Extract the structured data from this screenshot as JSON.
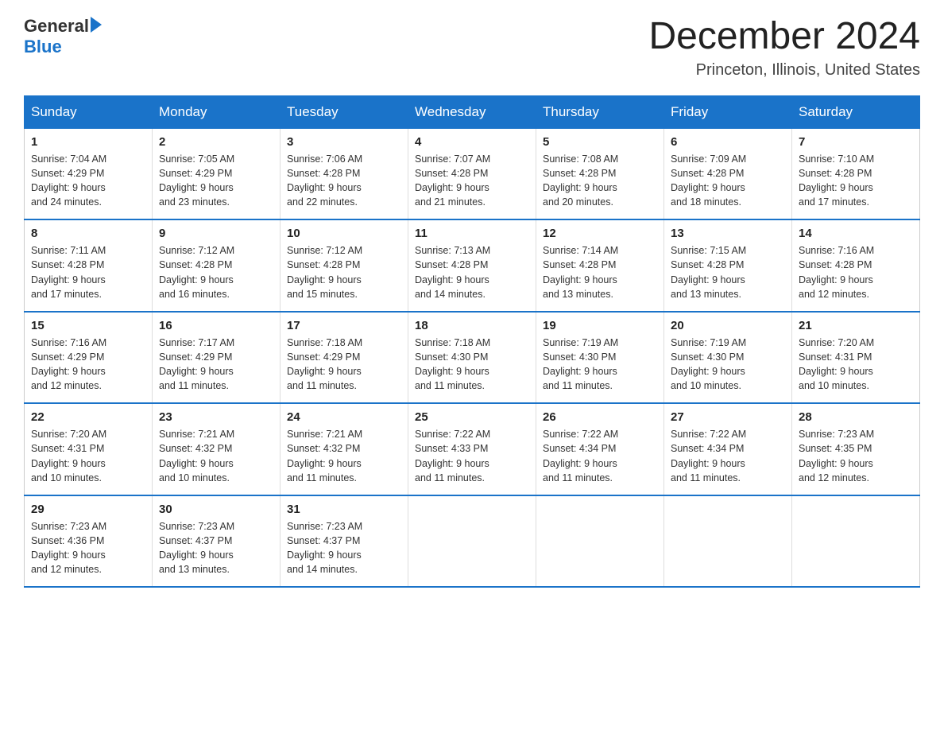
{
  "logo": {
    "text_general": "General",
    "text_blue": "Blue"
  },
  "header": {
    "month_title": "December 2024",
    "location": "Princeton, Illinois, United States"
  },
  "weekdays": [
    "Sunday",
    "Monday",
    "Tuesday",
    "Wednesday",
    "Thursday",
    "Friday",
    "Saturday"
  ],
  "weeks": [
    [
      {
        "day": "1",
        "sunrise": "7:04 AM",
        "sunset": "4:29 PM",
        "daylight": "9 hours and 24 minutes."
      },
      {
        "day": "2",
        "sunrise": "7:05 AM",
        "sunset": "4:29 PM",
        "daylight": "9 hours and 23 minutes."
      },
      {
        "day": "3",
        "sunrise": "7:06 AM",
        "sunset": "4:28 PM",
        "daylight": "9 hours and 22 minutes."
      },
      {
        "day": "4",
        "sunrise": "7:07 AM",
        "sunset": "4:28 PM",
        "daylight": "9 hours and 21 minutes."
      },
      {
        "day": "5",
        "sunrise": "7:08 AM",
        "sunset": "4:28 PM",
        "daylight": "9 hours and 20 minutes."
      },
      {
        "day": "6",
        "sunrise": "7:09 AM",
        "sunset": "4:28 PM",
        "daylight": "9 hours and 18 minutes."
      },
      {
        "day": "7",
        "sunrise": "7:10 AM",
        "sunset": "4:28 PM",
        "daylight": "9 hours and 17 minutes."
      }
    ],
    [
      {
        "day": "8",
        "sunrise": "7:11 AM",
        "sunset": "4:28 PM",
        "daylight": "9 hours and 17 minutes."
      },
      {
        "day": "9",
        "sunrise": "7:12 AM",
        "sunset": "4:28 PM",
        "daylight": "9 hours and 16 minutes."
      },
      {
        "day": "10",
        "sunrise": "7:12 AM",
        "sunset": "4:28 PM",
        "daylight": "9 hours and 15 minutes."
      },
      {
        "day": "11",
        "sunrise": "7:13 AM",
        "sunset": "4:28 PM",
        "daylight": "9 hours and 14 minutes."
      },
      {
        "day": "12",
        "sunrise": "7:14 AM",
        "sunset": "4:28 PM",
        "daylight": "9 hours and 13 minutes."
      },
      {
        "day": "13",
        "sunrise": "7:15 AM",
        "sunset": "4:28 PM",
        "daylight": "9 hours and 13 minutes."
      },
      {
        "day": "14",
        "sunrise": "7:16 AM",
        "sunset": "4:28 PM",
        "daylight": "9 hours and 12 minutes."
      }
    ],
    [
      {
        "day": "15",
        "sunrise": "7:16 AM",
        "sunset": "4:29 PM",
        "daylight": "9 hours and 12 minutes."
      },
      {
        "day": "16",
        "sunrise": "7:17 AM",
        "sunset": "4:29 PM",
        "daylight": "9 hours and 11 minutes."
      },
      {
        "day": "17",
        "sunrise": "7:18 AM",
        "sunset": "4:29 PM",
        "daylight": "9 hours and 11 minutes."
      },
      {
        "day": "18",
        "sunrise": "7:18 AM",
        "sunset": "4:30 PM",
        "daylight": "9 hours and 11 minutes."
      },
      {
        "day": "19",
        "sunrise": "7:19 AM",
        "sunset": "4:30 PM",
        "daylight": "9 hours and 11 minutes."
      },
      {
        "day": "20",
        "sunrise": "7:19 AM",
        "sunset": "4:30 PM",
        "daylight": "9 hours and 10 minutes."
      },
      {
        "day": "21",
        "sunrise": "7:20 AM",
        "sunset": "4:31 PM",
        "daylight": "9 hours and 10 minutes."
      }
    ],
    [
      {
        "day": "22",
        "sunrise": "7:20 AM",
        "sunset": "4:31 PM",
        "daylight": "9 hours and 10 minutes."
      },
      {
        "day": "23",
        "sunrise": "7:21 AM",
        "sunset": "4:32 PM",
        "daylight": "9 hours and 10 minutes."
      },
      {
        "day": "24",
        "sunrise": "7:21 AM",
        "sunset": "4:32 PM",
        "daylight": "9 hours and 11 minutes."
      },
      {
        "day": "25",
        "sunrise": "7:22 AM",
        "sunset": "4:33 PM",
        "daylight": "9 hours and 11 minutes."
      },
      {
        "day": "26",
        "sunrise": "7:22 AM",
        "sunset": "4:34 PM",
        "daylight": "9 hours and 11 minutes."
      },
      {
        "day": "27",
        "sunrise": "7:22 AM",
        "sunset": "4:34 PM",
        "daylight": "9 hours and 11 minutes."
      },
      {
        "day": "28",
        "sunrise": "7:23 AM",
        "sunset": "4:35 PM",
        "daylight": "9 hours and 12 minutes."
      }
    ],
    [
      {
        "day": "29",
        "sunrise": "7:23 AM",
        "sunset": "4:36 PM",
        "daylight": "9 hours and 12 minutes."
      },
      {
        "day": "30",
        "sunrise": "7:23 AM",
        "sunset": "4:37 PM",
        "daylight": "9 hours and 13 minutes."
      },
      {
        "day": "31",
        "sunrise": "7:23 AM",
        "sunset": "4:37 PM",
        "daylight": "9 hours and 14 minutes."
      },
      null,
      null,
      null,
      null
    ]
  ]
}
